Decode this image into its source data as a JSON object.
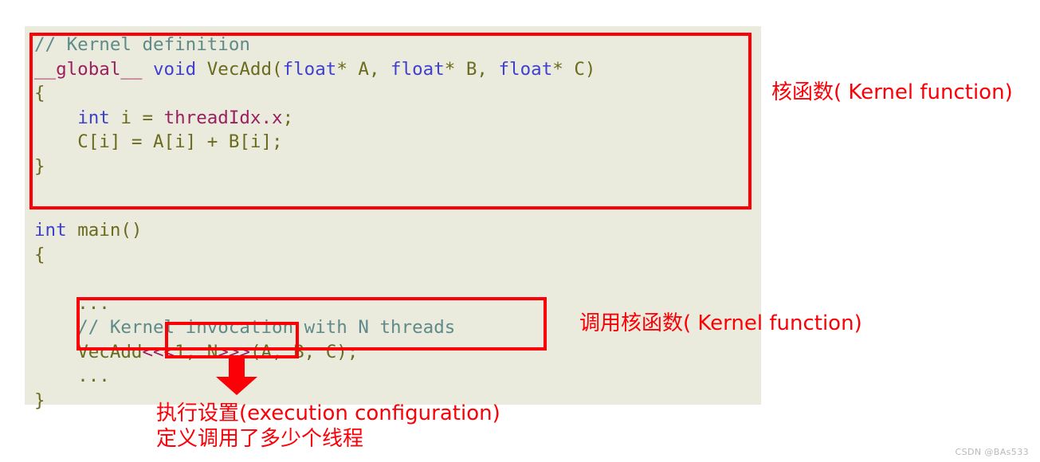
{
  "code": {
    "background_color": "#eaebdd",
    "language": "CUDA C++",
    "colors": {
      "comment": "#5f8a8a",
      "keyword": "#4040d0",
      "qualifier": "#9a2060",
      "identifier": "#6b6b1f",
      "annotation_red": "#fb0007"
    },
    "block_1_lines": [
      "// Kernel definition",
      "__global__ void VecAdd(float* A, float* B, float* C)",
      "{",
      "    int i = threadIdx.x;",
      "    C[i] = A[i] + B[i];",
      "}"
    ],
    "block_2_lines": [
      "int main()",
      "{",
      "    ...",
      "    // Kernel invocation with N threads",
      "    VecAdd<<<1, N>>>(A, B, C);",
      "    ...",
      "}"
    ],
    "tokens": {
      "comment_kernel_definition": "// Kernel definition",
      "qualifier_global": "__global__",
      "keyword_void": "void",
      "func_vecadd": "VecAdd",
      "keyword_float": "float",
      "param_a": "A",
      "param_b": "B",
      "param_c": "C",
      "keyword_int": "int",
      "var_i": "i",
      "builtin_threadidx": "threadIdx",
      "member_x": "x",
      "func_main": "main",
      "ellipsis": "...",
      "comment_kernel_invocation": "// Kernel invocation with N threads",
      "exec_config": "<<<1, N>>>",
      "grid_dim": "1",
      "block_dim": "N"
    }
  },
  "annotations": {
    "kernel_function": "核函数( Kernel function)",
    "call_kernel_function": "调用核函数( Kernel function)",
    "execution_configuration_line1": "执行设置(execution configuration)",
    "execution_configuration_line2": "定义调用了多少个线程"
  },
  "watermark": {
    "text": "CSDN @BAs533"
  }
}
